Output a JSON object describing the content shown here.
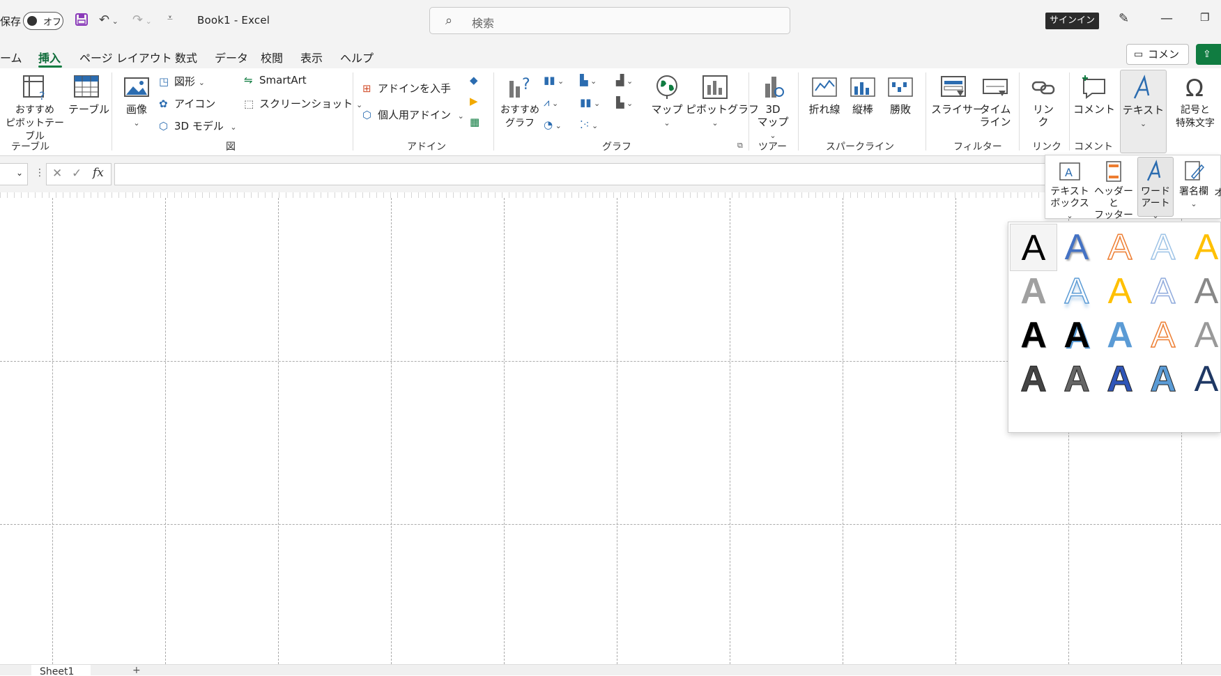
{
  "title_bar": {
    "autosave_label": "保存",
    "autosave_state": "オフ",
    "document_title": "Book1  -  Excel",
    "search_placeholder": "検索",
    "signin_label": "サインイン"
  },
  "menu_tabs": [
    {
      "label": "ーム"
    },
    {
      "label": "挿入",
      "active": true
    },
    {
      "label": "ページ レイアウト"
    },
    {
      "label": "数式"
    },
    {
      "label": "データ"
    },
    {
      "label": "校閲"
    },
    {
      "label": "表示"
    },
    {
      "label": "ヘルプ"
    }
  ],
  "menu_right": {
    "comment_label": "コメント",
    "share_label": "共"
  },
  "ribbon": {
    "groups": {
      "table": "テーブル",
      "illustrations": "図",
      "addins": "アドイン",
      "charts": "グラフ",
      "tours": "ツアー",
      "sparklines": "スパークライン",
      "filters": "フィルター",
      "links": "リンク",
      "comments": "コメント"
    },
    "buttons": {
      "recommended_pivot": "おすすめ\nピボットテーブル",
      "table": "テーブル",
      "image": "画像",
      "shapes": "図形",
      "icons": "アイコン",
      "models3d": "3D モデル",
      "smartart": "SmartArt",
      "screenshot": "スクリーンショット",
      "get_addins": "アドインを入手",
      "my_addins": "個人用アドイン",
      "recommended_charts": "おすすめ\nグラフ",
      "map": "マップ",
      "pivot_chart": "ピボットグラフ",
      "map3d": "3D\nマップ",
      "line": "折れ線",
      "column": "縦棒",
      "winloss": "勝敗",
      "slicer": "スライサー",
      "timeline": "タイム\nライン",
      "link": "リン\nク",
      "comment": "コメント",
      "text": "テキスト",
      "symbols": "記号と\n特殊文字"
    }
  },
  "text_submenu": {
    "textbox": "テキスト\nボックス",
    "header_footer": "ヘッダーと\nフッター",
    "wordart": "ワード\nアート",
    "signature": "署名欄",
    "object": "オ"
  },
  "wordart_styles": [
    {
      "glyph": "A",
      "style": "plain-black",
      "color": "#000000"
    },
    {
      "glyph": "A",
      "style": "blue-shadow",
      "color": "#4472c4"
    },
    {
      "glyph": "A",
      "style": "orange-outline",
      "color": "#ed7d31"
    },
    {
      "glyph": "A",
      "style": "light-blue-outline",
      "color": "#9dc3e6"
    },
    {
      "glyph": "A",
      "style": "gold-partial",
      "color": "#ffc000"
    },
    {
      "glyph": "A",
      "style": "gray-gradient",
      "color": "#a0a0a0"
    },
    {
      "glyph": "A",
      "style": "blue-reflection",
      "color": "#5b9bd5"
    },
    {
      "glyph": "A",
      "style": "gold-fill",
      "color": "#ffc000"
    },
    {
      "glyph": "A",
      "style": "lavender-outline",
      "color": "#8faadc"
    },
    {
      "glyph": "A",
      "style": "gray-partial",
      "color": "#888888"
    },
    {
      "glyph": "A",
      "style": "black-bold",
      "color": "#000000"
    },
    {
      "glyph": "A",
      "style": "black-blue-shadow",
      "color": "#000000"
    },
    {
      "glyph": "A",
      "style": "blue-gradient",
      "color": "#5b9bd5"
    },
    {
      "glyph": "A",
      "style": "orange-outline-thin",
      "color": "#ed7d31"
    },
    {
      "glyph": "A",
      "style": "gray-partial-2",
      "color": "#999999"
    },
    {
      "glyph": "A",
      "style": "dark-pattern",
      "color": "#444444"
    },
    {
      "glyph": "A",
      "style": "gray-pattern",
      "color": "#666666"
    },
    {
      "glyph": "A",
      "style": "blue-pattern",
      "color": "#2f55b8"
    },
    {
      "glyph": "A",
      "style": "light-blue-pattern",
      "color": "#5b9bd5"
    },
    {
      "glyph": "A",
      "style": "navy-partial",
      "color": "#1f3864"
    }
  ],
  "sheet_tabs": [
    {
      "label": "Sheet1"
    }
  ]
}
